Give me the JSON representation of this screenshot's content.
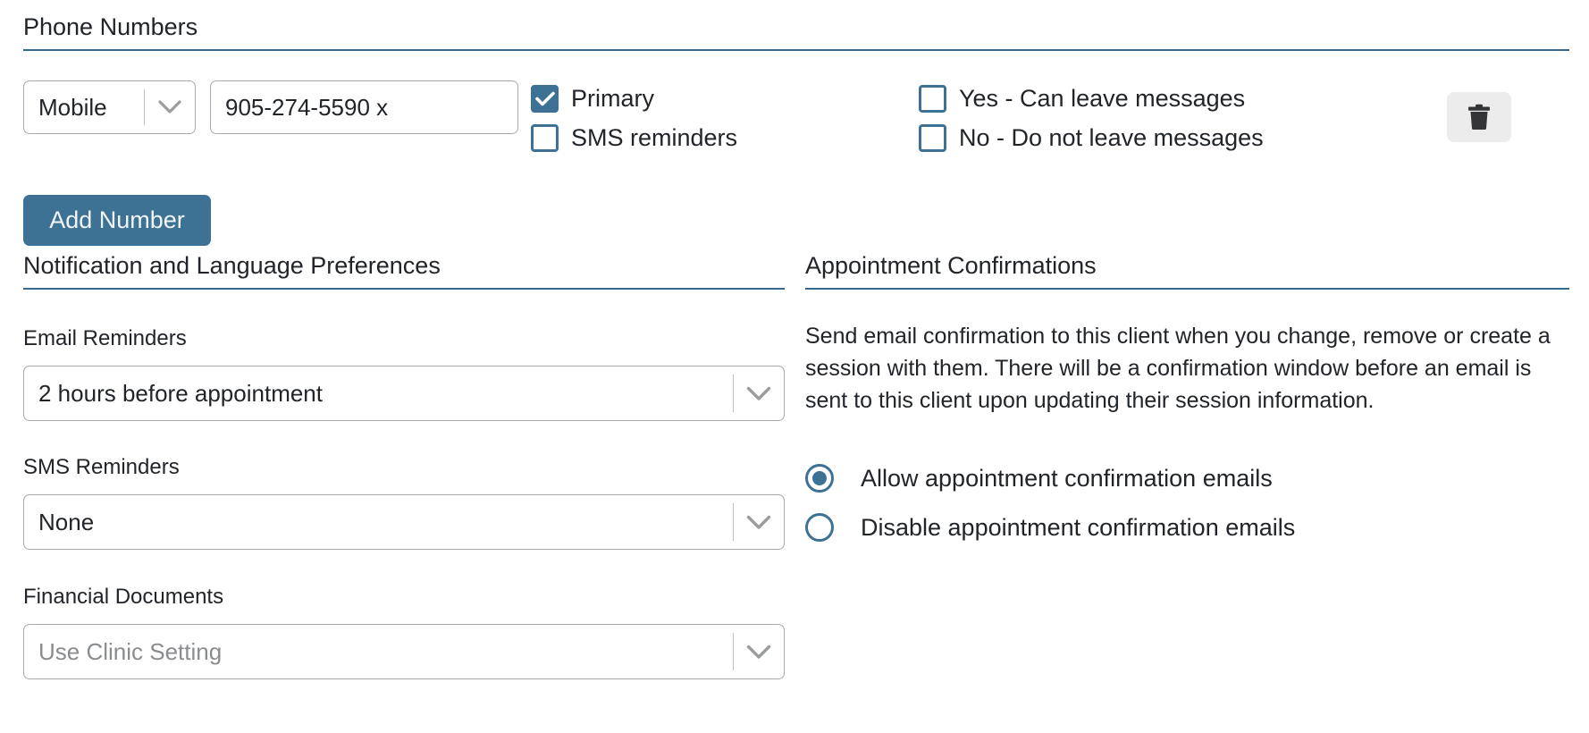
{
  "colors": {
    "accent": "#3d7294",
    "header_rule": "#356a8c",
    "text": "#212529",
    "placeholder": "#8a8d90",
    "input_border": "#a7a9ac",
    "trash_button_bg": "#ececec"
  },
  "sections": {
    "phone_numbers": {
      "title": "Phone Numbers"
    },
    "notification_language": {
      "title": "Notification and Language Preferences"
    },
    "appointment_confirmations": {
      "title": "Appointment Confirmations"
    }
  },
  "phone_row": {
    "type_select": {
      "value": "Mobile",
      "icon": "chevron-down-icon"
    },
    "number_input": {
      "value": "905-274-5590 x",
      "placeholder": "Phone number"
    },
    "checkboxes": [
      {
        "label": "Primary",
        "checked": true
      },
      {
        "label": "SMS reminders",
        "checked": false
      },
      {
        "label": "Yes - Can leave messages",
        "checked": false
      },
      {
        "label": "No - Do not leave messages",
        "checked": false
      }
    ],
    "delete_button": {
      "icon": "trash-icon",
      "label": ""
    }
  },
  "add_number_button": {
    "label": "Add Number"
  },
  "preferences": {
    "fields": [
      {
        "label": "Email Reminders",
        "value": "2 hours before appointment",
        "is_placeholder": false,
        "icon": "chevron-down-icon"
      },
      {
        "label": "SMS Reminders",
        "value": "None",
        "is_placeholder": false,
        "icon": "chevron-down-icon"
      },
      {
        "label": "Financial Documents",
        "value": "Use Clinic Setting",
        "is_placeholder": true,
        "icon": "chevron-down-icon"
      }
    ]
  },
  "appointment_confirmations": {
    "description": "Send email confirmation to this client when you change, remove or create a session with them. There will be a confirmation window before an email is sent to this client upon updating their session information.",
    "options": [
      {
        "label": "Allow appointment confirmation emails",
        "selected": true
      },
      {
        "label": "Disable appointment confirmation emails",
        "selected": false
      }
    ]
  }
}
